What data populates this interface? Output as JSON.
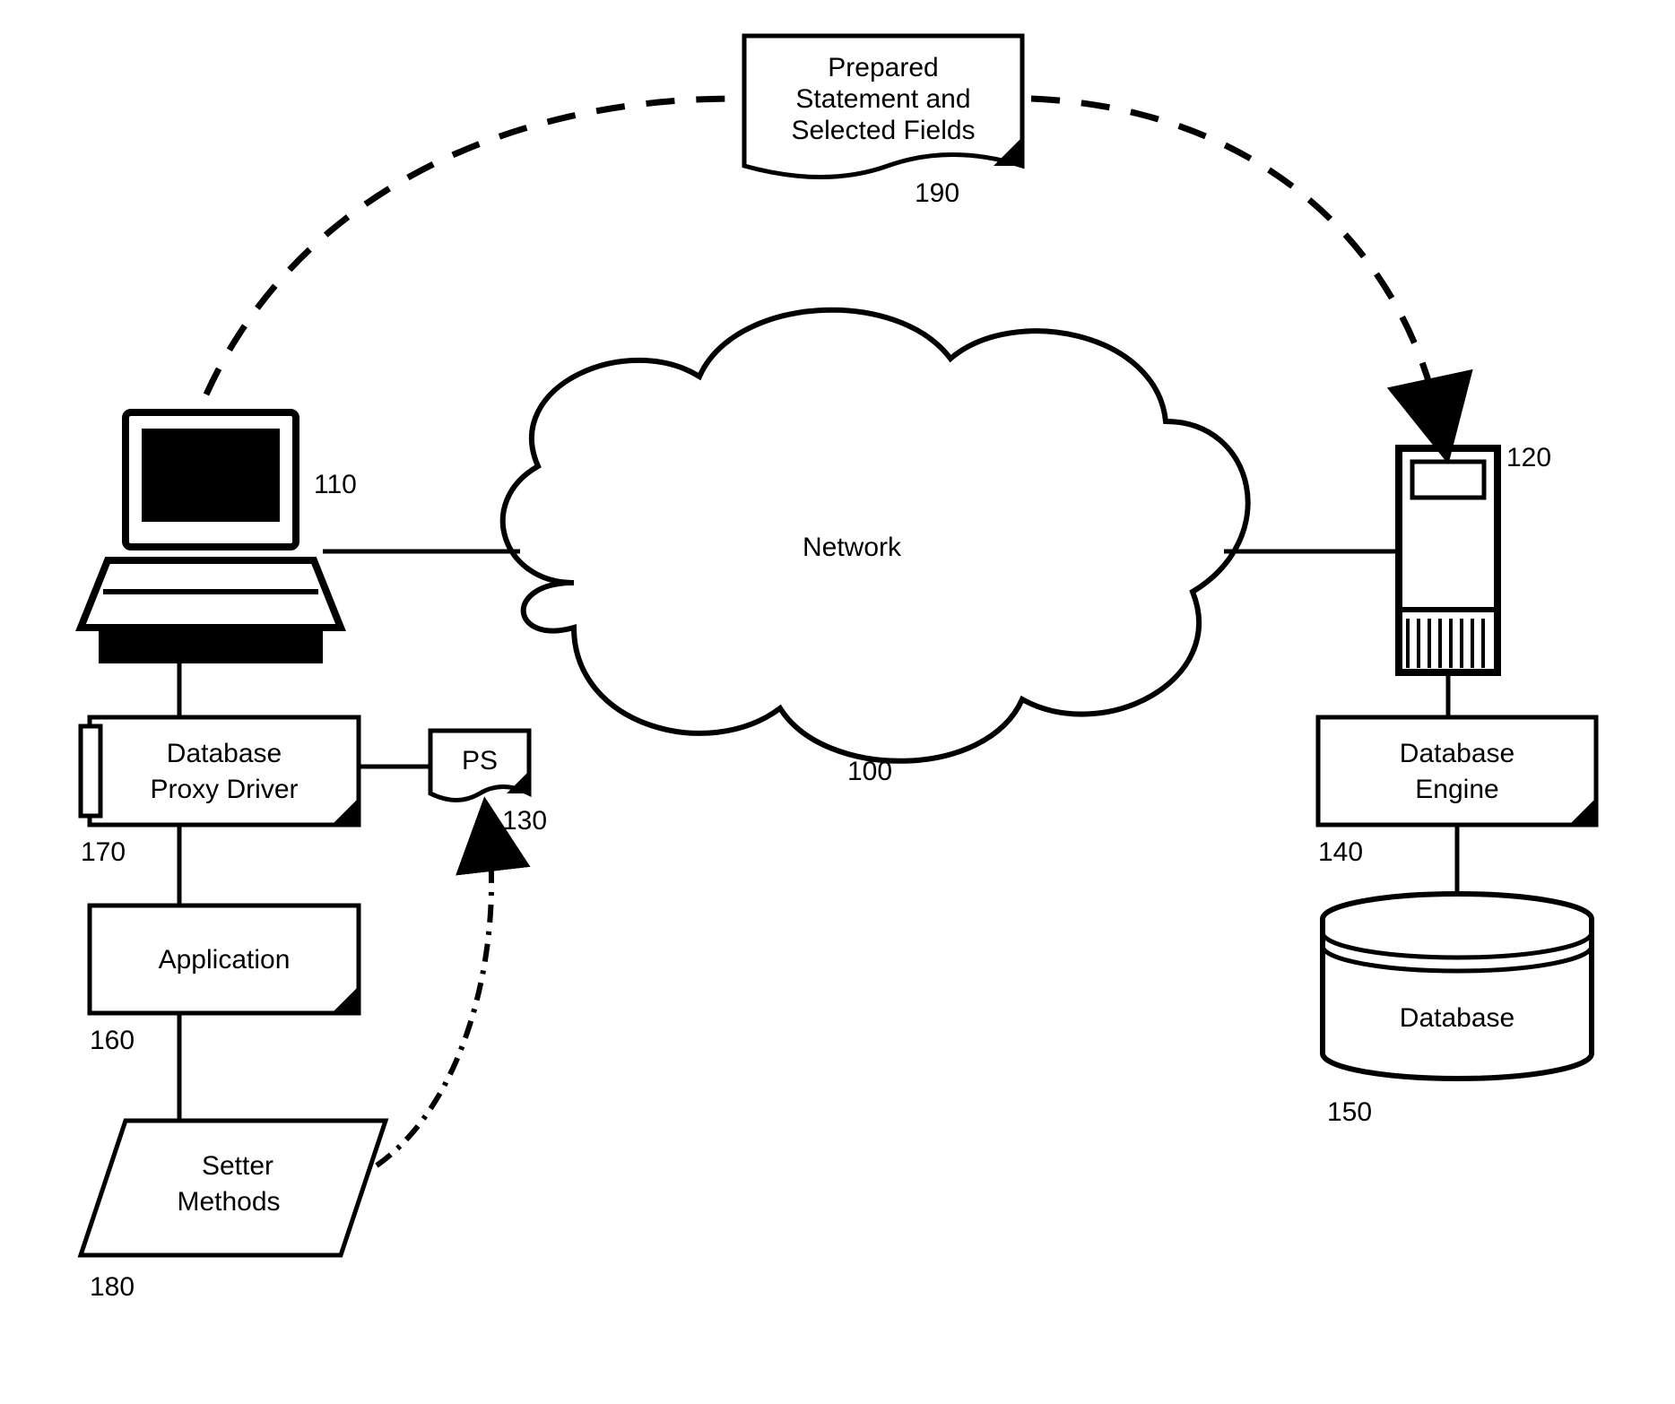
{
  "diagram": {
    "nodes": {
      "network": {
        "label": "Network",
        "ref": "100"
      },
      "client": {
        "label": "",
        "ref": "110"
      },
      "server": {
        "label": "",
        "ref": "120"
      },
      "ps": {
        "label": "PS",
        "ref": "130"
      },
      "db_engine": {
        "label": "Database Engine",
        "ref": "140"
      },
      "database": {
        "label": "Database",
        "ref": "150"
      },
      "application": {
        "label": "Application",
        "ref": "160"
      },
      "proxy_driver": {
        "label": "Database Proxy Driver",
        "ref": "170"
      },
      "setter_methods": {
        "label": "Setter Methods",
        "ref": "180"
      },
      "prepared_stmt": {
        "label": "Prepared Statement and Selected Fields",
        "ref": "190"
      }
    },
    "edges": [
      {
        "from": "client",
        "to": "network",
        "style": "solid"
      },
      {
        "from": "network",
        "to": "server",
        "style": "solid"
      },
      {
        "from": "client",
        "to": "proxy_driver",
        "style": "solid"
      },
      {
        "from": "proxy_driver",
        "to": "ps",
        "style": "solid"
      },
      {
        "from": "proxy_driver",
        "to": "application",
        "style": "solid"
      },
      {
        "from": "application",
        "to": "setter_methods",
        "style": "solid"
      },
      {
        "from": "server",
        "to": "db_engine",
        "style": "solid"
      },
      {
        "from": "db_engine",
        "to": "database",
        "style": "solid"
      },
      {
        "from": "setter_methods",
        "to": "ps",
        "style": "dash-dot",
        "direction": "arrow"
      },
      {
        "from": "client",
        "to": "server",
        "style": "dashed",
        "via": "prepared_stmt",
        "direction": "arrow"
      }
    ]
  }
}
